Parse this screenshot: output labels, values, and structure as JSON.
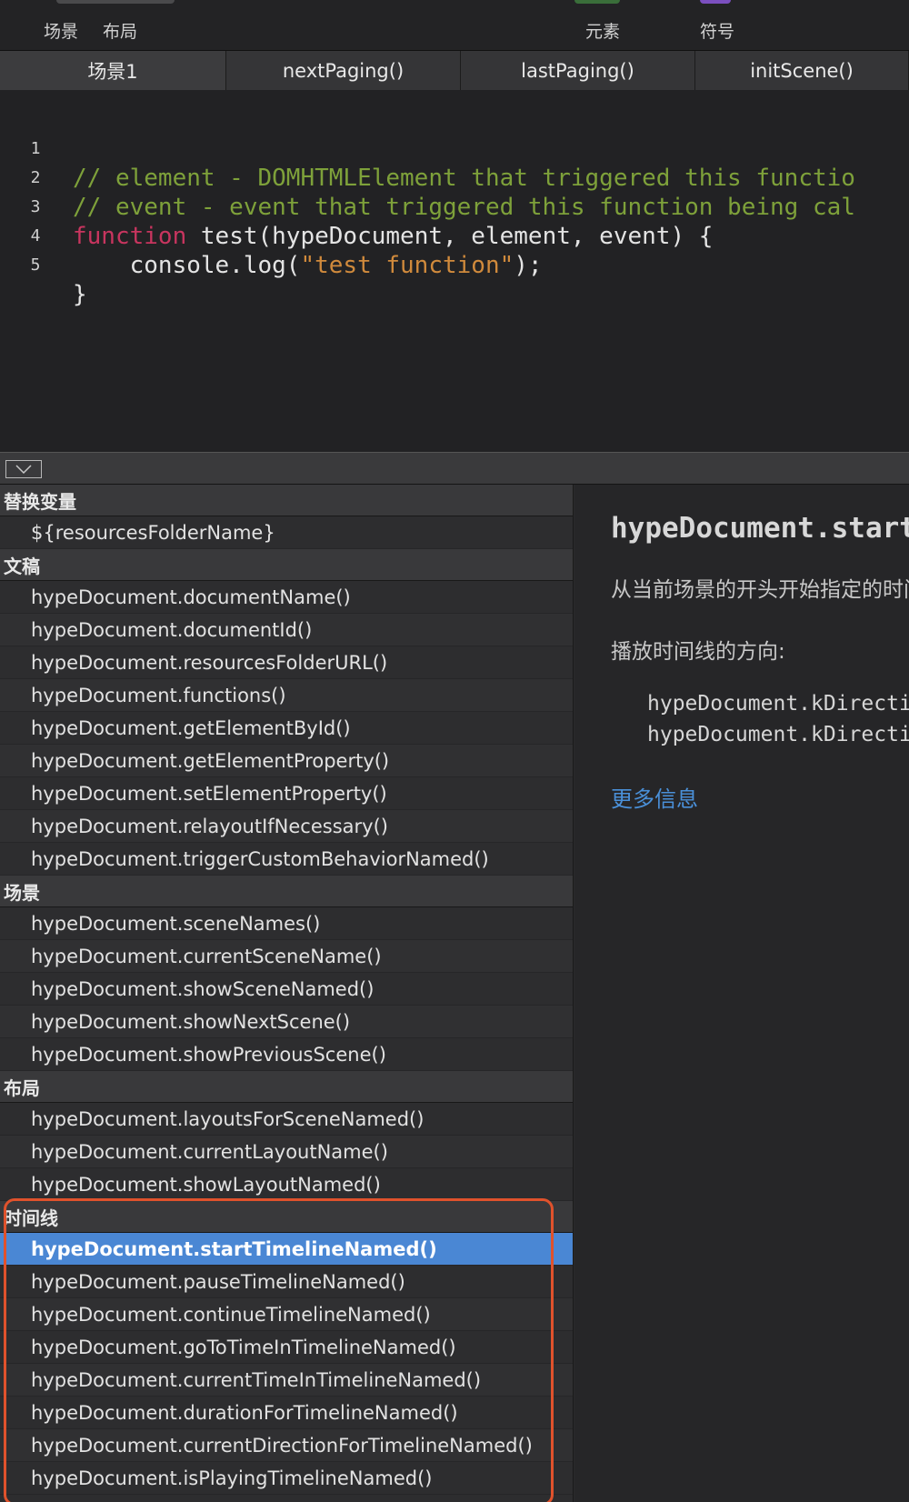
{
  "toolbar": {
    "left_items": [
      "场景",
      "布局"
    ],
    "right_items": [
      "元素",
      "符号"
    ]
  },
  "tabs": [
    "场景1",
    "nextPaging()",
    "lastPaging()",
    "initScene()"
  ],
  "editor": {
    "lines": [
      {
        "n": "1",
        "segments": [
          {
            "t": "// element - DOMHTMLElement that triggered this functio",
            "k": "comment"
          }
        ]
      },
      {
        "n": "2",
        "segments": [
          {
            "t": "// event - event that triggered this function being cal",
            "k": "comment"
          }
        ]
      },
      {
        "n": "3",
        "segments": [
          {
            "t": "function",
            "k": "keyword"
          },
          {
            "t": " test(hypeDocument, element, event) {",
            "k": "plain"
          }
        ]
      },
      {
        "n": "4",
        "segments": [
          {
            "t": "    console.log(",
            "k": "plain"
          },
          {
            "t": "\"test function\"",
            "k": "string"
          },
          {
            "t": ");",
            "k": "plain"
          }
        ]
      },
      {
        "n": "5",
        "segments": [
          {
            "t": "}",
            "k": "plain"
          }
        ]
      }
    ]
  },
  "api_list": {
    "sections": [
      {
        "header": "替换变量",
        "items": [
          "${resourcesFolderName}"
        ]
      },
      {
        "header": "文稿",
        "items": [
          "hypeDocument.documentName()",
          "hypeDocument.documentId()",
          "hypeDocument.resourcesFolderURL()",
          "hypeDocument.functions()",
          "hypeDocument.getElementById()",
          "hypeDocument.getElementProperty()",
          "hypeDocument.setElementProperty()",
          "hypeDocument.relayoutIfNecessary()",
          "hypeDocument.triggerCustomBehaviorNamed()"
        ]
      },
      {
        "header": "场景",
        "items": [
          "hypeDocument.sceneNames()",
          "hypeDocument.currentSceneName()",
          "hypeDocument.showSceneNamed()",
          "hypeDocument.showNextScene()",
          "hypeDocument.showPreviousScene()"
        ]
      },
      {
        "header": "布局",
        "items": [
          "hypeDocument.layoutsForSceneNamed()",
          "hypeDocument.currentLayoutName()",
          "hypeDocument.showLayoutNamed()"
        ]
      },
      {
        "header": "时间线",
        "items": [
          "hypeDocument.startTimelineNamed()",
          "hypeDocument.pauseTimelineNamed()",
          "hypeDocument.continueTimelineNamed()",
          "hypeDocument.goToTimeInTimelineNamed()",
          "hypeDocument.currentTimeInTimelineNamed()",
          "hypeDocument.durationForTimelineNamed()",
          "hypeDocument.currentDirectionForTimelineNamed()",
          "hypeDocument.isPlayingTimelineNamed()"
        ]
      }
    ],
    "selected": "hypeDocument.startTimelineNamed()"
  },
  "detail": {
    "title": "hypeDocument.startTimelineNamed(",
    "description": "从当前场景的开头开始指定的时间线",
    "direction_label": "播放时间线的方向:",
    "direction_values": [
      "hypeDocument.kDirectionForward",
      "hypeDocument.kDirectionReverse"
    ],
    "more_info": "更多信息"
  },
  "colors": {
    "selection": "#4a87d4",
    "highlight_outline": "#e0522c",
    "link": "#4a90d9",
    "comment": "#7ea13a",
    "keyword": "#c8355f",
    "string": "#d08a3c"
  }
}
